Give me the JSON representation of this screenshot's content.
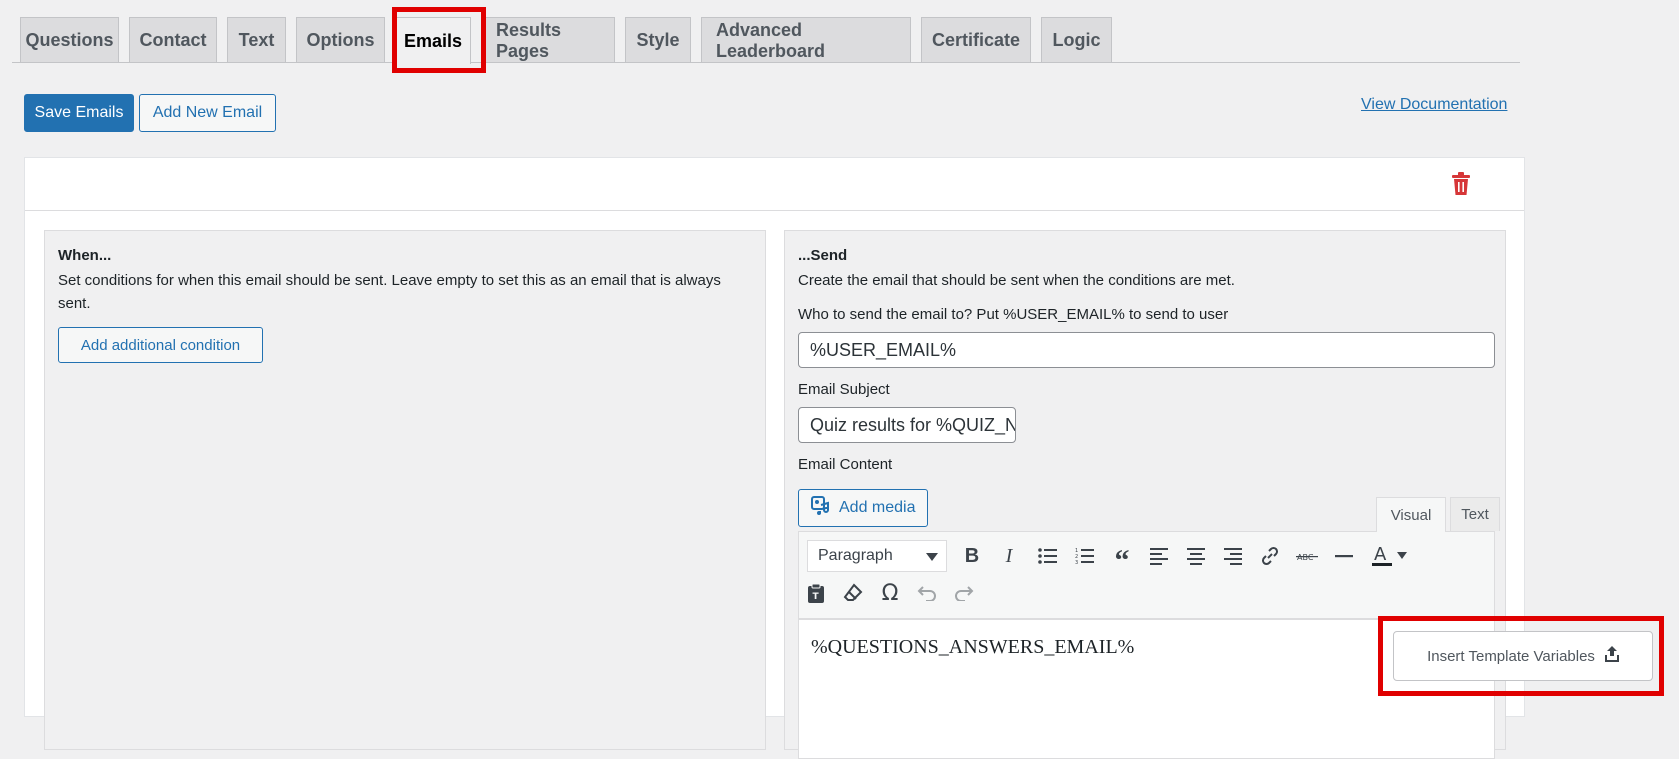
{
  "tabs": [
    {
      "label": "Questions",
      "active": false
    },
    {
      "label": "Contact",
      "active": false
    },
    {
      "label": "Text",
      "active": false
    },
    {
      "label": "Options",
      "active": false
    },
    {
      "label": "Emails",
      "active": true
    },
    {
      "label": "Results Pages",
      "active": false
    },
    {
      "label": "Style",
      "active": false
    },
    {
      "label": "Advanced Leaderboard",
      "active": false
    },
    {
      "label": "Certificate",
      "active": false
    },
    {
      "label": "Logic",
      "active": false
    }
  ],
  "toolbar": {
    "save_label": "Save Emails",
    "add_label": "Add New Email",
    "doc_link": "View Documentation"
  },
  "when": {
    "title": "When...",
    "description": "Set conditions for when this email should be sent. Leave empty to set this as an email that is always sent.",
    "add_condition_label": "Add additional condition"
  },
  "send": {
    "title": "...Send",
    "description": "Create the email that should be sent when the conditions are met.",
    "to_label": "Who to send the email to? Put %USER_EMAIL% to send to user",
    "to_value": "%USER_EMAIL%",
    "subject_label": "Email Subject",
    "subject_value": "Quiz results for %QUIZ_NAME%",
    "content_label": "Email Content",
    "add_media_label": "Add media",
    "visual_tab": "Visual",
    "text_tab": "Text",
    "format_value": "Paragraph",
    "content_value": "%QUESTIONS_ANSWERS_EMAIL%",
    "insert_variables_label": "Insert Template Variables"
  },
  "colors": {
    "accent": "#2271b1",
    "highlight": "#e00000",
    "delete": "#d63638"
  }
}
